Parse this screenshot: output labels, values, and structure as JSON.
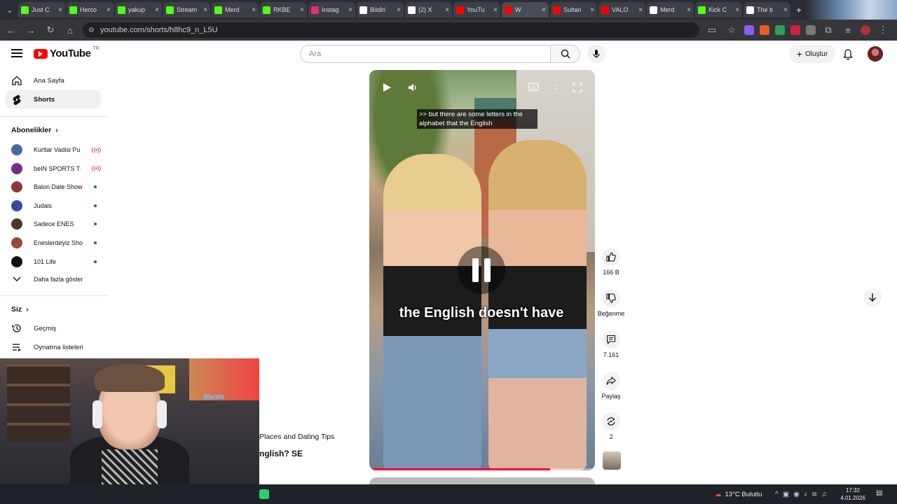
{
  "browser": {
    "tabs": [
      {
        "title": "Just C",
        "icon": "kick-icon",
        "color": "#53fc18"
      },
      {
        "title": "Herco",
        "icon": "kick-icon",
        "color": "#53fc18"
      },
      {
        "title": "yakup",
        "icon": "kick-icon",
        "color": "#53fc18"
      },
      {
        "title": "Stream",
        "icon": "kick-icon",
        "color": "#53fc18"
      },
      {
        "title": "Merd",
        "icon": "kick-icon",
        "color": "#53fc18"
      },
      {
        "title": "RKBE",
        "icon": "kick-icon",
        "color": "#53fc18"
      },
      {
        "title": "Instag",
        "icon": "instagram-icon",
        "color": "#e1306c"
      },
      {
        "title": "Bildiri",
        "icon": "x-icon",
        "color": "#ffffff"
      },
      {
        "title": "(2) X",
        "icon": "x-icon",
        "color": "#ffffff"
      },
      {
        "title": "YouTu",
        "icon": "youtube-icon",
        "color": "#ff0000"
      },
      {
        "title": "W",
        "icon": "youtube-icon",
        "color": "#ff0000"
      },
      {
        "title": "Sultan",
        "icon": "youtube-icon",
        "color": "#ff0000"
      },
      {
        "title": "VALO",
        "icon": "youtube-icon",
        "color": "#ff0000"
      },
      {
        "title": "Merd",
        "icon": "tiktok-icon",
        "color": "#ffffff"
      },
      {
        "title": "Kick C",
        "icon": "kick-icon",
        "color": "#53fc18"
      },
      {
        "title": "The b",
        "icon": "openai-icon",
        "color": "#ffffff"
      }
    ],
    "url": "youtube.com/shorts/h8hc9_n_L5U"
  },
  "header": {
    "logo_text": "YouTube",
    "country": "TR",
    "search_placeholder": "Ara",
    "create_label": "Oluştur"
  },
  "sidebar": {
    "nav": [
      {
        "label": "Ana Sayfa",
        "icon": "home-icon"
      },
      {
        "label": "Shorts",
        "icon": "shorts-icon"
      }
    ],
    "subscriptions_heading": "Abonelikler",
    "subscriptions": [
      {
        "name": "Kurtlar Vadisi Pu...",
        "status": "live",
        "color": "#4a6a9a"
      },
      {
        "name": "beIN SPORTS Tü...",
        "status": "live",
        "color": "#7a2a8a"
      },
      {
        "name": "Balon Date Show",
        "status": "new",
        "color": "#8a3a3a"
      },
      {
        "name": "Judais",
        "status": "new",
        "color": "#3a4a9a"
      },
      {
        "name": "Sadece ENES",
        "status": "new",
        "color": "#4a3a2a"
      },
      {
        "name": "Eneslerdeyiz Show",
        "status": "new",
        "color": "#9a4a3a"
      },
      {
        "name": "101 Life",
        "status": "new",
        "color": "#111111"
      }
    ],
    "show_more": "Daha fazla göster",
    "you_heading": "Siz",
    "you_items": [
      {
        "label": "Geçmiş",
        "icon": "history-icon"
      },
      {
        "label": "Oynatma listeleri",
        "icon": "playlists-icon"
      }
    ]
  },
  "short": {
    "caption_top": ">> but there are some letters in the alphabet that the English",
    "caption_burned": "the English doesn't have",
    "progress": 0.8,
    "title_fragment": "Places and Dating Tips",
    "title_fragment2": "nglish? SE"
  },
  "actions": {
    "likes": "166 B",
    "dislike_label": "Beğenme",
    "comments": "7.161",
    "share_label": "Paylaş",
    "remix_count": "2"
  },
  "taskbar": {
    "weather": "13°C Bulutlu",
    "time": "17:32",
    "date": "4.01.2026"
  }
}
